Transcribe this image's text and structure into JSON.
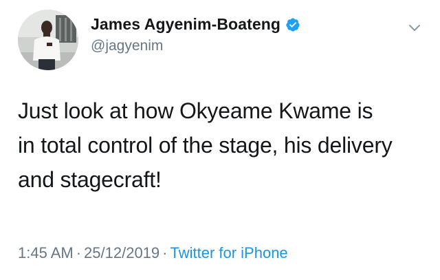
{
  "user": {
    "display_name": "James Agyenim-Boateng",
    "handle": "@jagyenim",
    "verified": true
  },
  "tweet": {
    "text_lines": [
      "Just look at how Okyeame Kwame is",
      "in total control of the stage, his delivery",
      "and stagecraft!"
    ],
    "time": "1:45 AM",
    "separator": "·",
    "date": "25/12/2019",
    "source": "Twitter for iPhone"
  },
  "icons": {
    "verified": "verified-badge-icon",
    "menu": "chevron-down-icon"
  },
  "colors": {
    "text": "#14171a",
    "secondary": "#657786",
    "accent": "#1b95e0"
  }
}
